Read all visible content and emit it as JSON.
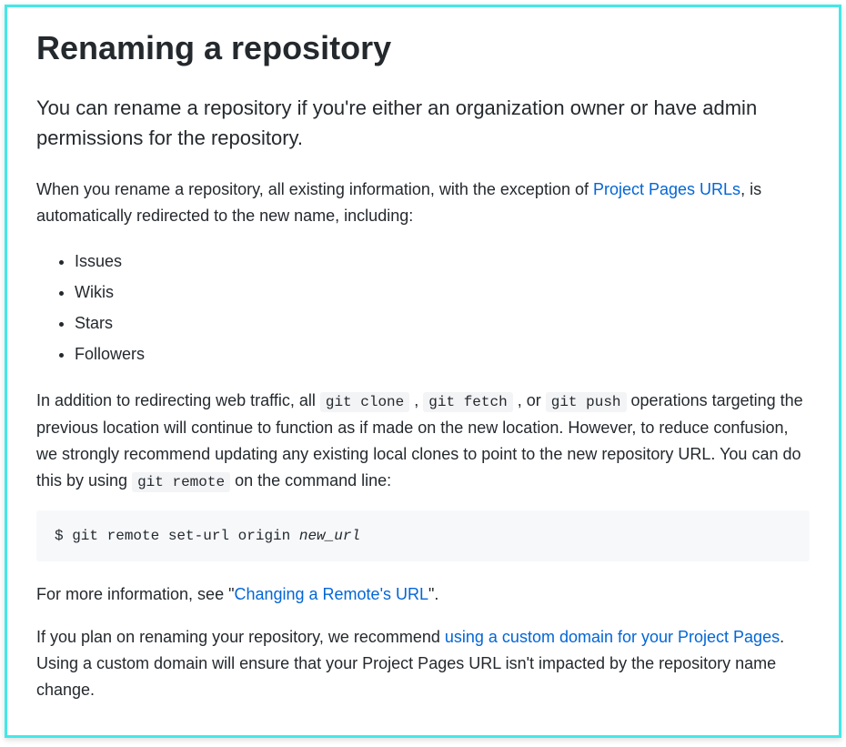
{
  "title": "Renaming a repository",
  "lead": "You can rename a repository if you're either an organization owner or have admin permissions for the repository.",
  "para1_pre": "When you rename a repository, all existing information, with the exception of ",
  "para1_link": "Project Pages URLs",
  "para1_post": ", is automatically redirected to the new name, including:",
  "list": {
    "item1": "Issues",
    "item2": "Wikis",
    "item3": "Stars",
    "item4": "Followers"
  },
  "para2_a": "In addition to redirecting web traffic, all ",
  "code1": "git clone",
  "para2_b": " , ",
  "code2": "git fetch",
  "para2_c": " , or ",
  "code3": "git push",
  "para2_d": " operations targeting the previous location will continue to function as if made on the new location. However, to reduce confusion, we strongly recommend updating any existing local clones to point to the new repository URL. You can do this by using ",
  "code4": "git remote",
  "para2_e": " on the command line:",
  "codeblock_prompt": "$ ",
  "codeblock_cmd": "git remote set-url origin ",
  "codeblock_arg": "new_url",
  "para3_a": "For more information, see \"",
  "para3_link": "Changing a Remote's URL",
  "para3_b": "\".",
  "para4_a": "If you plan on renaming your repository, we recommend ",
  "para4_link": "using a custom domain for your Project Pages",
  "para4_b": ". Using a custom domain will ensure that your Project Pages URL isn't impacted by the repository name change."
}
